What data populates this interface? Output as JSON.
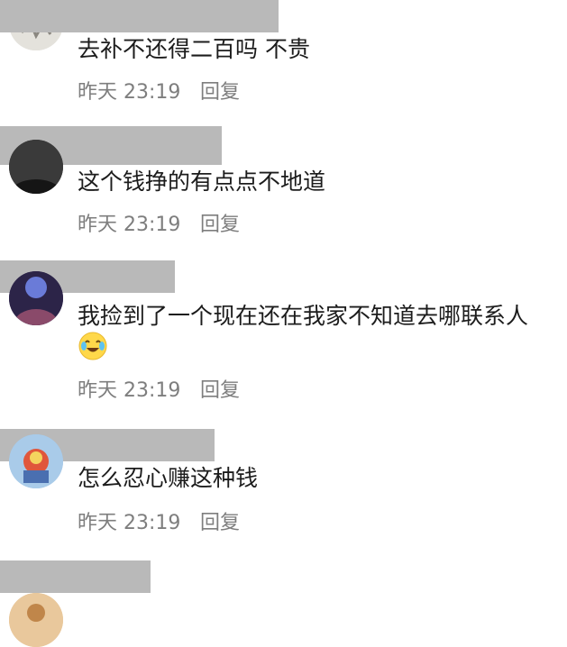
{
  "comments": [
    {
      "text": "去补不还得二百吗 不贵",
      "time": "昨天 23:19",
      "reply_label": "回复"
    },
    {
      "text": "这个钱挣的有点点不地道",
      "time": "昨天 23:19",
      "reply_label": "回复"
    },
    {
      "text": "我捡到了一个现在还在我家不知道去哪联系人",
      "time": "昨天 23:19",
      "reply_label": "回复",
      "emoji": "crying-laughing-emoji"
    },
    {
      "text": "怎么忍心赚这种钱",
      "time": "昨天 23:19",
      "reply_label": "回复"
    }
  ],
  "colors": {
    "redaction": "#b9b9b9",
    "comment_text": "#1c1c1c",
    "meta_text": "#7e7e7e"
  }
}
